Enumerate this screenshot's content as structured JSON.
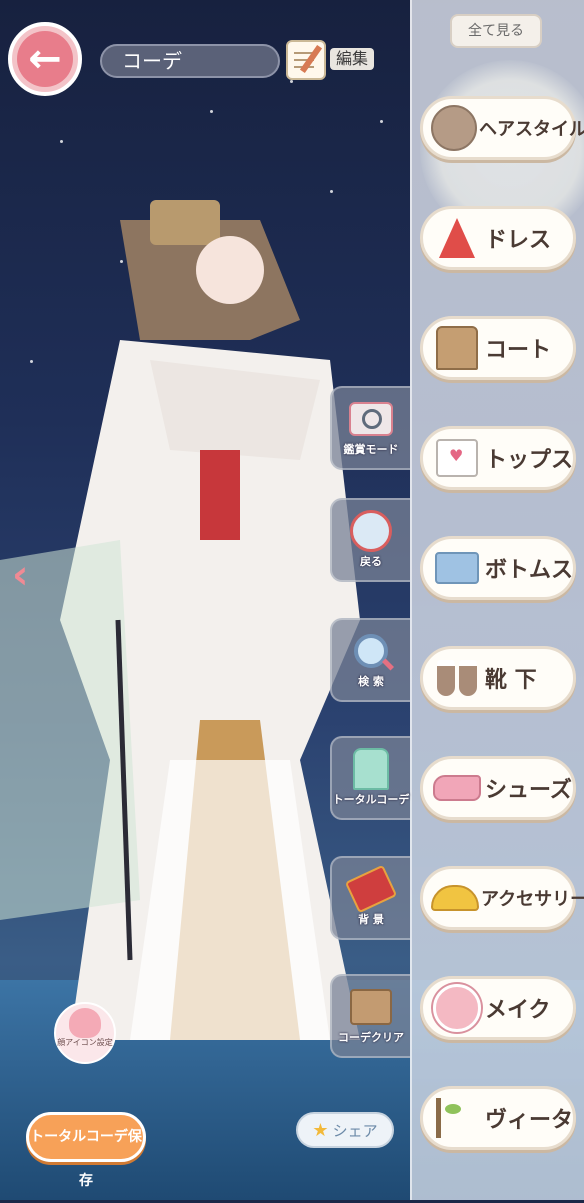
{
  "header": {
    "outfit_name": "コーデ",
    "edit_label": "編集",
    "see_all_label": "全て見る"
  },
  "categories": [
    {
      "label": "ヘアスタイル",
      "icon": "hair-icon"
    },
    {
      "label": "ドレス",
      "icon": "dress-icon"
    },
    {
      "label": "コート",
      "icon": "coat-icon"
    },
    {
      "label": "トップス",
      "icon": "tops-icon"
    },
    {
      "label": "ボトムス",
      "icon": "bottoms-icon"
    },
    {
      "label": "靴 下",
      "icon": "socks-icon"
    },
    {
      "label": "シューズ",
      "icon": "shoes-icon"
    },
    {
      "label": "アクセサリー",
      "icon": "accessory-icon"
    },
    {
      "label": "メイク",
      "icon": "makeup-icon"
    },
    {
      "label": "ヴィータ",
      "icon": "vita-icon"
    }
  ],
  "side_tools": [
    {
      "label": "鑑賞モード",
      "icon": "camera-icon"
    },
    {
      "label": "戻る",
      "icon": "undo-icon"
    },
    {
      "label": "検 索",
      "icon": "search-icon"
    },
    {
      "label": "トータルコーデ",
      "icon": "total-outfit-icon"
    },
    {
      "label": "背 景",
      "icon": "paint-brush-icon"
    },
    {
      "label": "コーデクリア",
      "icon": "clear-box-icon"
    }
  ],
  "footer": {
    "face_icon_label": "顔アイコン設定",
    "save_label": "トータルコーデ保存",
    "share_label": "シェア"
  },
  "colors": {
    "accent_pink": "#e87d8b",
    "save_orange": "#f7a158",
    "panel_bg": "#dce1ec"
  }
}
